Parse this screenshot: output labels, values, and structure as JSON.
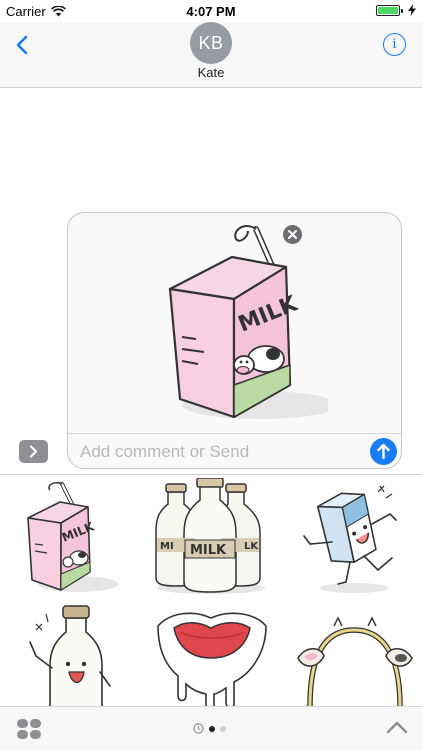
{
  "status_bar": {
    "carrier": "Carrier",
    "time": "4:07 PM",
    "battery_color": "#4cd964"
  },
  "header": {
    "contact_initials": "KB",
    "contact_name": "Kate"
  },
  "compose": {
    "placeholder": "Add comment or Send",
    "value": "",
    "sticker": "pink milk carton with cow"
  },
  "drawer": {
    "stickers": [
      "pink milk carton with cow",
      "three milk bottles",
      "dancing blue milk carton",
      "waving milk bottle",
      "cartoon mouth",
      "cow ears headband"
    ],
    "pages": [
      "recent-stickers",
      "page-1",
      "page-2"
    ],
    "active_page": 1
  },
  "colors": {
    "accent": "#1a7cf5",
    "avatar": "#979ba4"
  }
}
